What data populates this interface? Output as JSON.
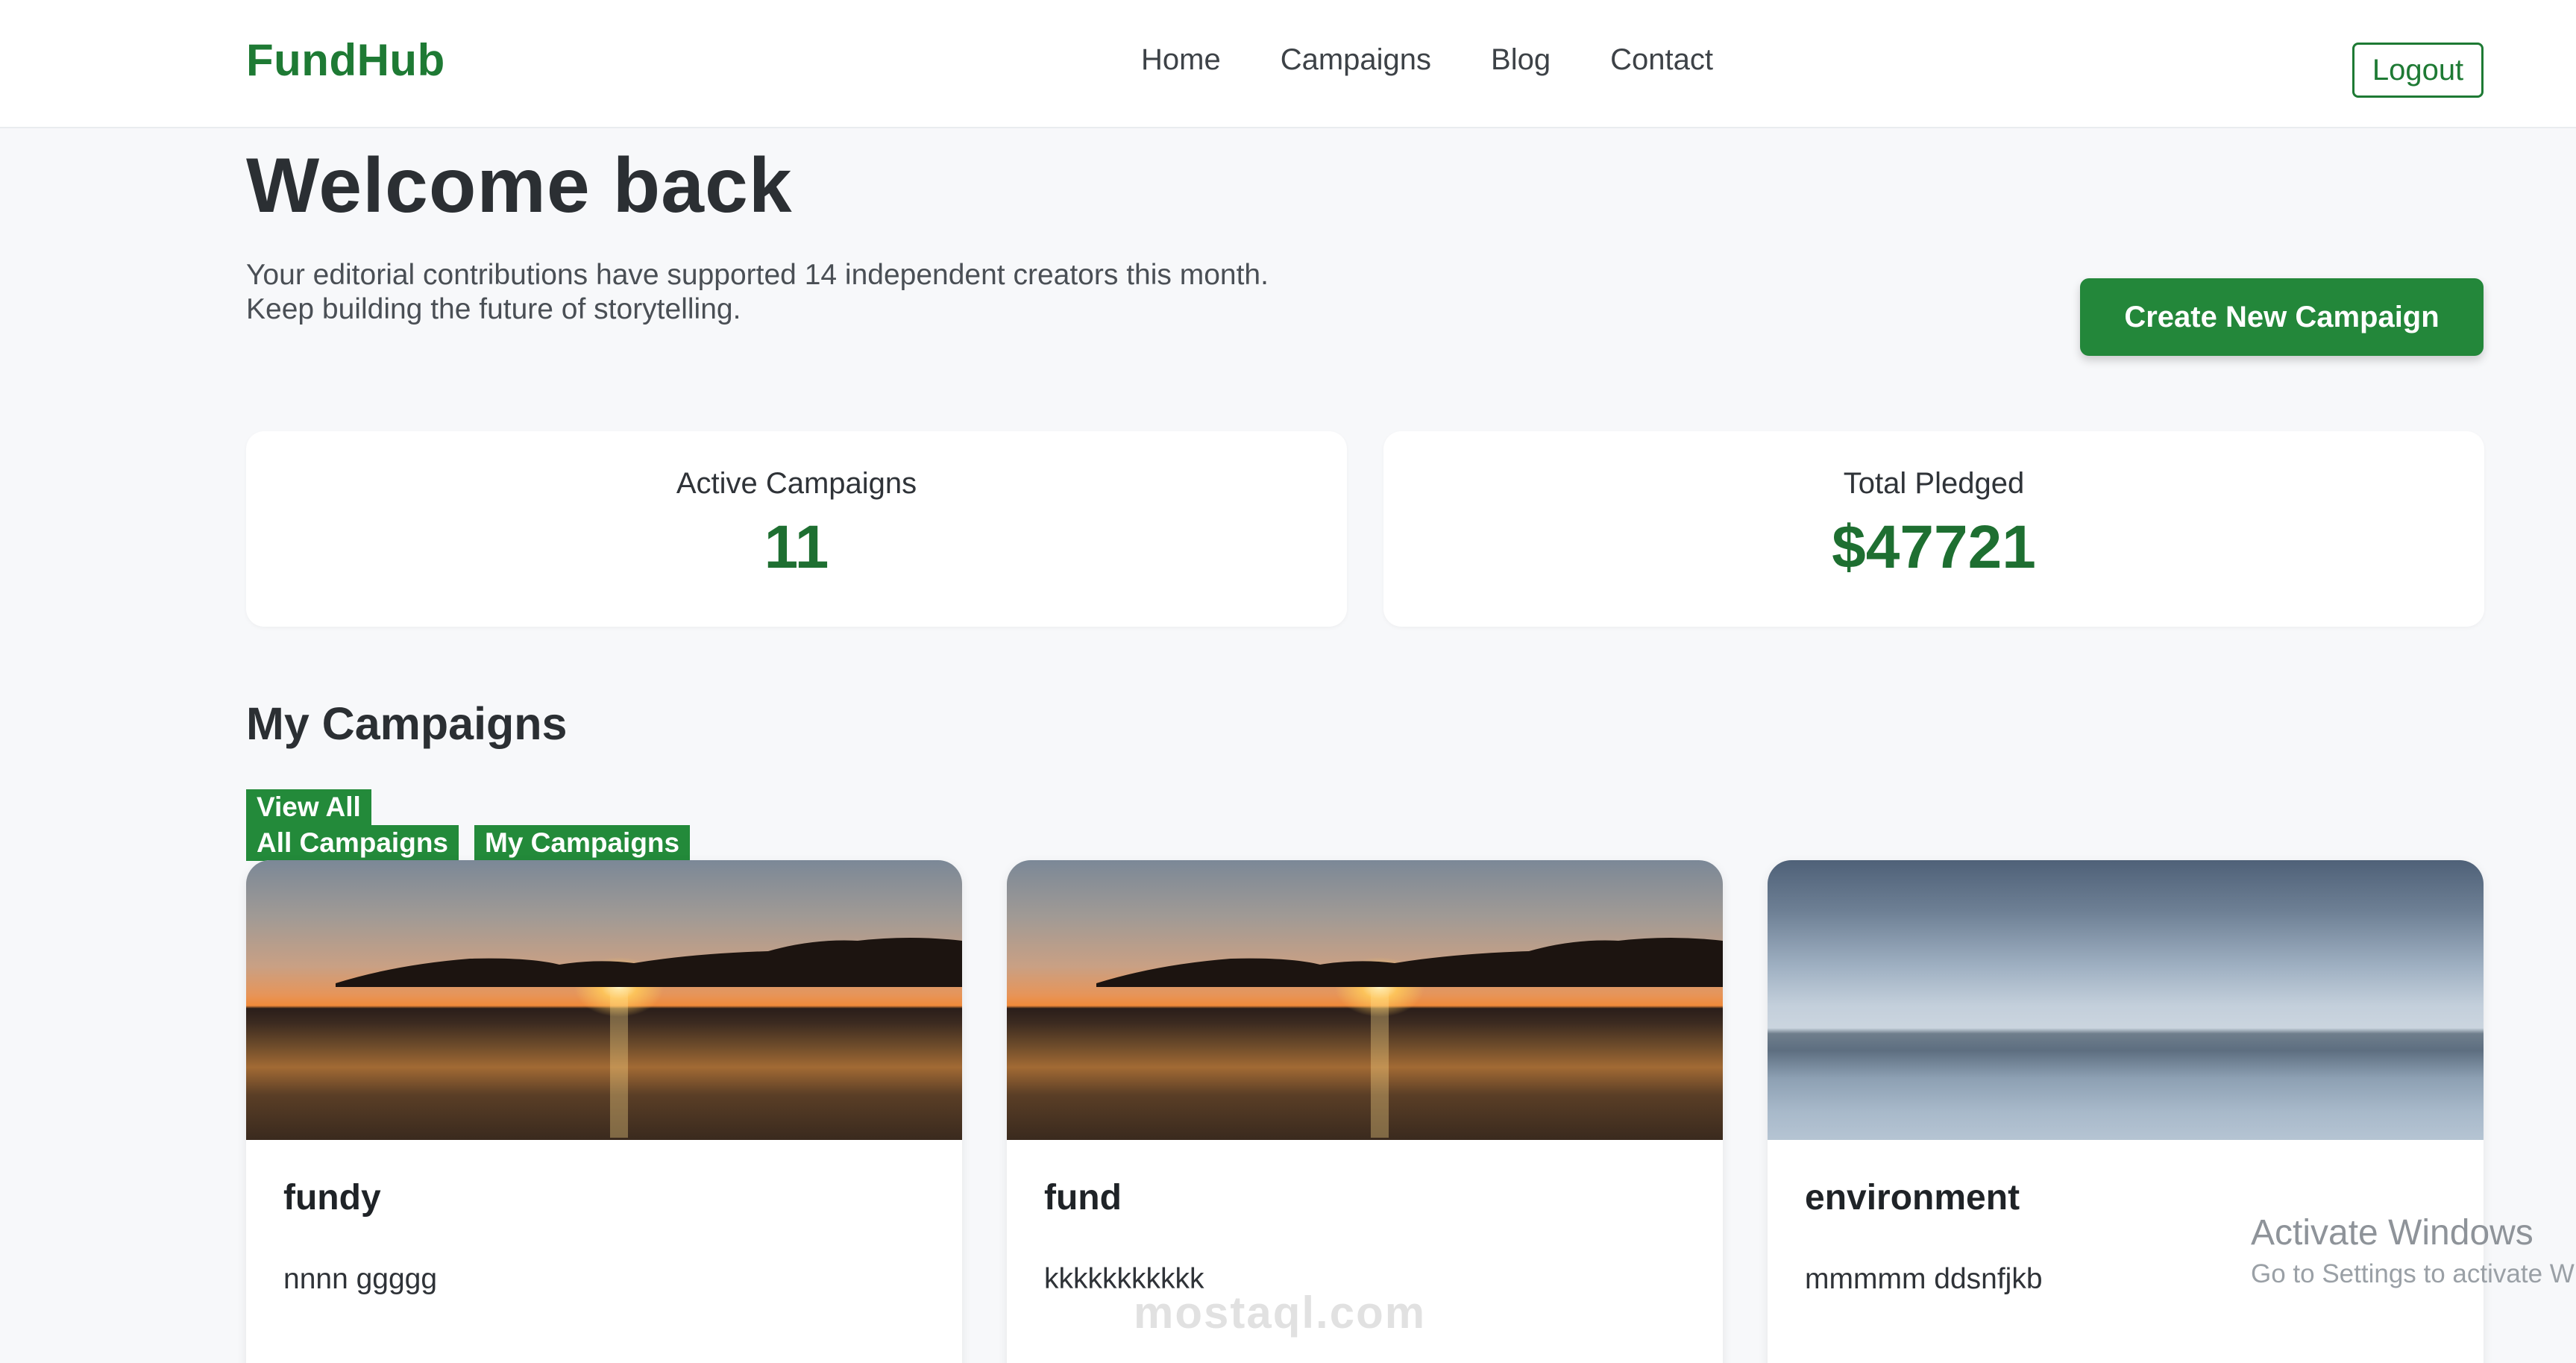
{
  "nav": {
    "brand": "FundHub",
    "links": [
      "Home",
      "Campaigns",
      "Blog",
      "Contact"
    ],
    "logout_label": "Logout"
  },
  "hero": {
    "title": "Welcome back",
    "subtitle_line1": "Your editorial contributions have supported 14 independent creators this month.",
    "subtitle_line2": "Keep building the future of storytelling.",
    "create_label": "Create New Campaign"
  },
  "stats": {
    "active_label": "Active Campaigns",
    "active_value": "11",
    "pledged_label": "Total Pledged",
    "pledged_value": "$47721"
  },
  "campaigns": {
    "title": "My Campaigns",
    "view_all_label": "View All",
    "filter_all_label": "All Campaigns",
    "filter_mine_label": "My Campaigns",
    "items": [
      {
        "title": "fundy",
        "description": "nnnn ggggg"
      },
      {
        "title": "fund",
        "description": "kkkkkkkkkkk"
      },
      {
        "title": "environment",
        "description": "mmmmm ddsnfjkb"
      }
    ]
  },
  "watermarks": {
    "windows_line1": "Activate Windows",
    "windows_line2": "Go to Settings to activate Windows.",
    "site": "mostaql.com"
  },
  "colors": {
    "brand_green": "#1e7a34",
    "button_green": "#23873a",
    "background": "#f7f8fa"
  }
}
